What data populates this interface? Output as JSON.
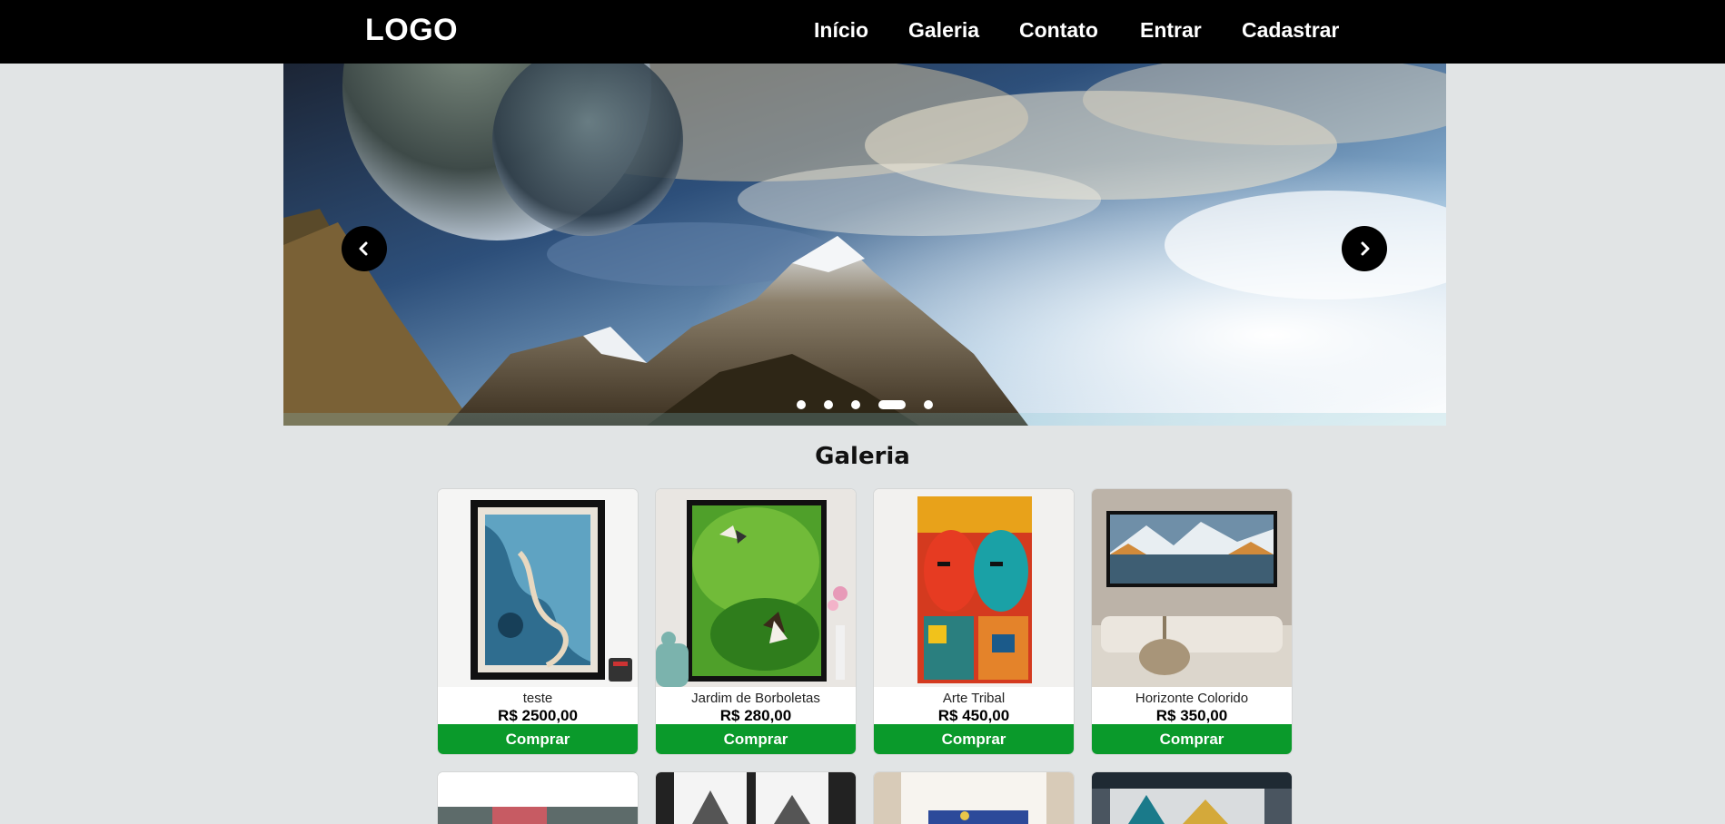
{
  "navbar": {
    "logo": "LOGO",
    "links": [
      {
        "label": "Início"
      },
      {
        "label": "Galeria"
      },
      {
        "label": "Contato"
      },
      {
        "label": "Entrar"
      },
      {
        "label": "Cadastrar"
      }
    ]
  },
  "carousel": {
    "slide_count": 5,
    "active_index": 3,
    "prev_icon": "chevron-left-icon",
    "next_icon": "chevron-right-icon"
  },
  "gallery": {
    "title": "Galeria",
    "buy_label": "Comprar",
    "products": [
      {
        "name": "teste",
        "price": "R$ 2500,00"
      },
      {
        "name": "Jardim de Borboletas",
        "price": "R$ 280,00"
      },
      {
        "name": "Arte Tribal",
        "price": "R$ 450,00"
      },
      {
        "name": "Horizonte Colorido",
        "price": "R$ 350,00"
      }
    ]
  },
  "colors": {
    "navbar_bg": "#000000",
    "page_bg": "#e1e4e5",
    "buy_button": "#0a9a2b"
  }
}
